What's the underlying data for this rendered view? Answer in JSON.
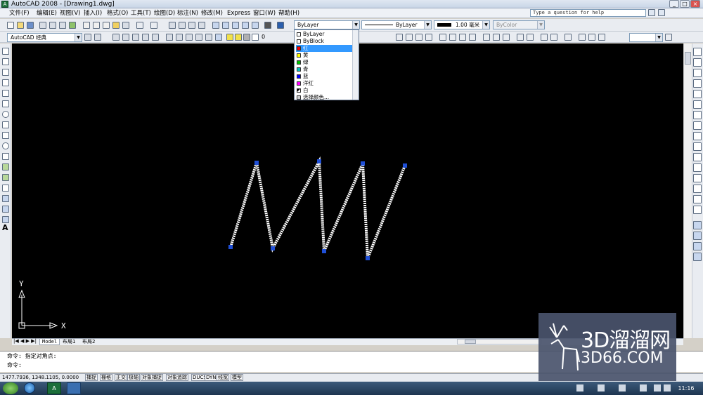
{
  "window": {
    "title": "AutoCAD 2008 - [Drawing1.dwg]"
  },
  "menu": [
    "文件(F)",
    "编辑(E)",
    "视图(V)",
    "插入(I)",
    "格式(O)",
    "工具(T)",
    "绘图(D)",
    "标注(N)",
    "修改(M)",
    "Express",
    "窗口(W)",
    "帮助(H)"
  ],
  "help_search": {
    "placeholder": "Type a question for help"
  },
  "toolbar": {
    "color_select": "ByLayer",
    "linetype_select": "ByLayer",
    "lineweight_select": "1.00 毫米",
    "plotstyle_select": "ByColor",
    "workspace_select": "AutoCAD 经典",
    "layer_value": "0"
  },
  "color_dropdown": {
    "items": [
      {
        "label": "ByLayer",
        "color": "#ffffff"
      },
      {
        "label": "ByBlock",
        "color": "#ffffff"
      },
      {
        "label": "红",
        "color": "#ff0000",
        "highlighted": true
      },
      {
        "label": "黄",
        "color": "#ffff00"
      },
      {
        "label": "绿",
        "color": "#00c000"
      },
      {
        "label": "青",
        "color": "#00c0c0"
      },
      {
        "label": "蓝",
        "color": "#0000ff"
      },
      {
        "label": "洋红",
        "color": "#ff00ff"
      },
      {
        "label": "白",
        "color": "#ffffff"
      },
      {
        "label": "选择颜色...",
        "color": "#cccccc"
      }
    ]
  },
  "layout_tabs": [
    "Model",
    "布局1",
    "布局2"
  ],
  "ucs": {
    "x_label": "X",
    "y_label": "Y"
  },
  "command": {
    "line1": "命令: 指定对角点:",
    "line2": "命令:"
  },
  "status": {
    "coords": "1477.7936, 1348.1105, 0.0000",
    "toggles": [
      "捕捉",
      "栅格",
      "正交",
      "极轴",
      "对象捕捉",
      "对象追踪",
      "DUCS",
      "DYN",
      "线宽",
      "模型"
    ]
  },
  "clock": "11:16",
  "watermark": {
    "main": "3D溜溜网",
    "sub": "3D66.COM"
  }
}
